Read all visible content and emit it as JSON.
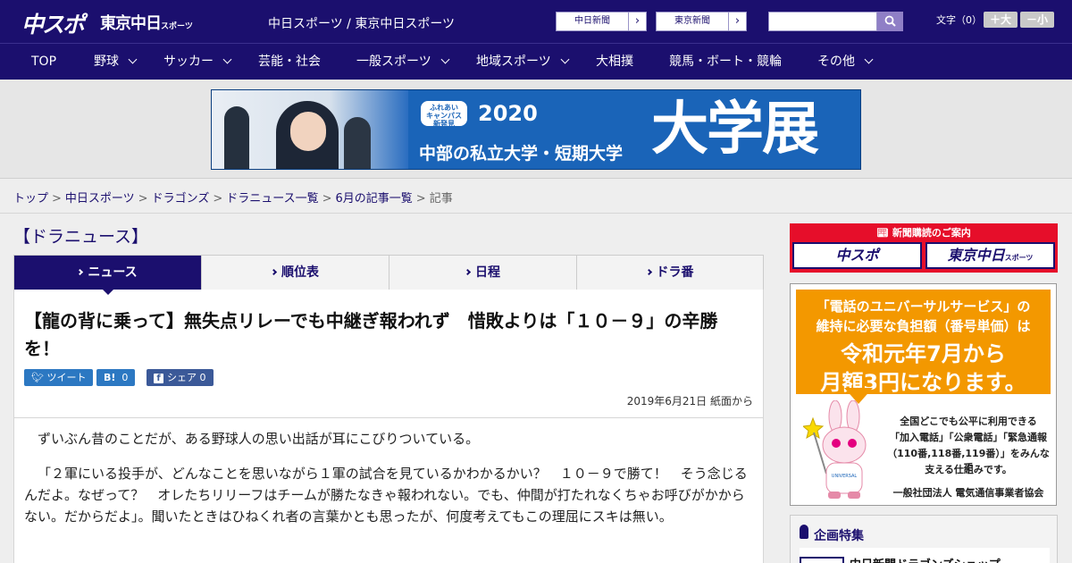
{
  "header": {
    "logo_chuspo": "中スポ",
    "logo_tokyo": "東京中日",
    "logo_tokyo_small": "スポーツ",
    "site_title": "中日スポーツ / 東京中日スポーツ",
    "ext_links": [
      "中日新聞",
      "東京新聞"
    ],
    "search_placeholder": "",
    "font_label": "文字（0）",
    "font_bigger": "＋大",
    "font_smaller": "－小"
  },
  "nav": {
    "items": [
      {
        "label": "TOP",
        "has_menu": false
      },
      {
        "label": "野球",
        "has_menu": true
      },
      {
        "label": "サッカー",
        "has_menu": true
      },
      {
        "label": "芸能・社会",
        "has_menu": false
      },
      {
        "label": "一般スポーツ",
        "has_menu": true
      },
      {
        "label": "地域スポーツ",
        "has_menu": true
      },
      {
        "label": "大相撲",
        "has_menu": false
      },
      {
        "label": "競馬・ボート・競輪",
        "has_menu": false
      },
      {
        "label": "その他",
        "has_menu": true
      }
    ]
  },
  "ad_banner": {
    "badge_lines": [
      "ふれあい",
      "キャンパス",
      "新発見"
    ],
    "year": "2020",
    "subtitle": "中部の私立大学・短期大学",
    "big_text": "大学展"
  },
  "breadcrumb": {
    "links": [
      "トップ",
      "中日スポーツ",
      "ドラゴンズ",
      "ドラニュース一覧",
      "6月の記事一覧"
    ],
    "current": "記事"
  },
  "section_title": "【ドラニュース】",
  "tabs": [
    "ニュース",
    "順位表",
    "日程",
    "ドラ番"
  ],
  "article": {
    "headline": "【龍の背に乗って】無失点リレーでも中継ぎ報われず　惜敗よりは「１０－９」の辛勝を！",
    "share": {
      "tweet_label": "ツイート",
      "hatena_label": "B!",
      "hatena_count": "0",
      "facebook_label": "シェア",
      "facebook_count": "0"
    },
    "date": "2019年6月21日 紙面から",
    "paragraphs": [
      "ずいぶん昔のことだが、ある野球人の思い出話が耳にこびりついている。",
      "「２軍にいる投手が、どんなことを思いながら１軍の試合を見ているかわかるかい？　１０－９で勝て！　そう念じるんだよ。なぜって？　オレたちリリーフはチームが勝たなきゃ報われない。でも、仲間が打たれなくちゃお呼びがかからない。だからだよ」。聞いたときはひねくれ者の言葉かとも思ったが、何度考えてもこの理屈にスキは無い。"
    ]
  },
  "sidebar": {
    "subscribe_head": "新聞購読のご案内",
    "subscribe_chuspo": "中スポ",
    "subscribe_tokyo": "東京中日",
    "subscribe_tokyo_small": "スポーツ",
    "universal_ad": {
      "line1": "「電話のユニバーサルサービス」の",
      "line2": "維持に必要な負担額（番号単価）は",
      "line3": "令和元年7月から",
      "line4": "月額3円になります。",
      "body1": "全国どこでも公平に利用できる",
      "body2": "「加入電話」「公衆電話」「緊急通報",
      "body3": "（110番,118番,119番）」をみんなで",
      "body4": "支える仕組みです。",
      "org": "一般社団法人 電気通信事業者協会"
    },
    "plan_title": "企画特集",
    "plan_item": "中日新聞ドラゴンズショップ"
  },
  "colors": {
    "brand_navy": "#1b0f6e",
    "accent_red": "#e60e2a",
    "ad_orange": "#f39800",
    "ad_blue": "#1a64b8"
  }
}
